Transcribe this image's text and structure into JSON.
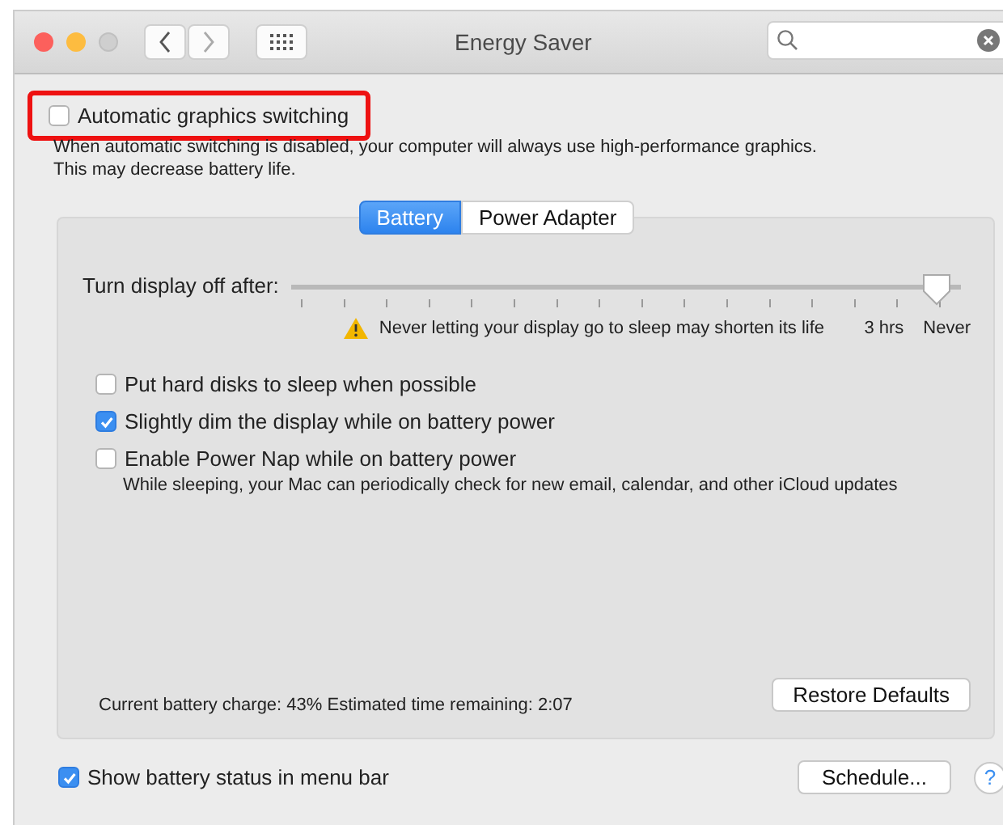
{
  "window": {
    "title": "Energy Saver"
  },
  "graphics_switching": {
    "label": "Automatic graphics switching",
    "checked": false,
    "highlighted": true,
    "description": "When automatic switching is disabled, your computer will always use high-performance graphics.\nThis may decrease battery life."
  },
  "tabs": [
    {
      "label": "Battery",
      "selected": true
    },
    {
      "label": "Power Adapter",
      "selected": false
    }
  ],
  "display_slider": {
    "label": "Turn display off after:",
    "level": 0.985,
    "warning": "Never letting your display go to sleep may shorten its life",
    "tick_labels": [
      "3 hrs",
      "Never"
    ]
  },
  "options": [
    {
      "label": "Put hard disks to sleep when possible",
      "checked": false
    },
    {
      "label": "Slightly dim the display while on battery power",
      "checked": true
    },
    {
      "label": "Enable Power Nap while on battery power",
      "checked": false,
      "description": "While sleeping, your Mac can periodically check for new email, calendar, and other iCloud updates"
    }
  ],
  "battery_info": "Current battery charge: 43%  Estimated time remaining: 2:07",
  "restore_button": "Restore Defaults",
  "menu_bar_status": {
    "label": "Show battery status in menu bar",
    "checked": true
  },
  "schedule_button": "Schedule...",
  "help_button": "?"
}
